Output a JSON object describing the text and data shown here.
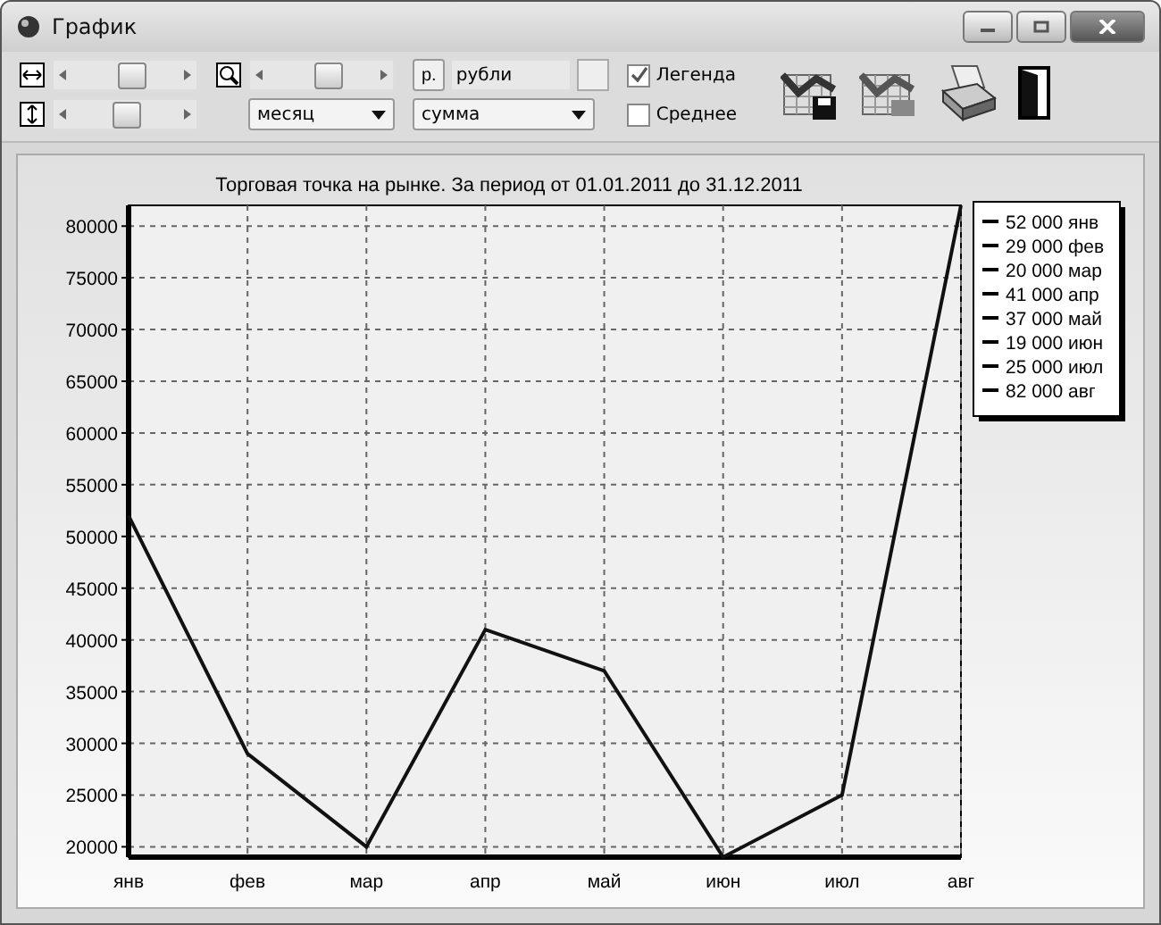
{
  "window": {
    "title": "График"
  },
  "toolbar": {
    "h_scale": {
      "level": 0.55
    },
    "v_scale": {
      "level": 0.5
    },
    "zoom": {
      "level": 0.55
    },
    "period": {
      "value": "месяц"
    },
    "currency_button": "р.",
    "currency": {
      "value": "рубли"
    },
    "measure": {
      "value": "сумма"
    },
    "checkboxes": [
      {
        "label": "Легенда",
        "checked": true
      },
      {
        "label": "Среднее",
        "checked": false
      }
    ]
  },
  "chart": {
    "legend": [
      "52 000 янв",
      "29 000 фев",
      "20 000 мар",
      "41 000 апр",
      "37 000 май",
      "19 000 июн",
      "25 000 июл",
      "82 000 авг"
    ],
    "chart_data": {
      "type": "line",
      "title": "Торговая точка на рынке. За период от 01.01.2011 до 31.12.2011",
      "categories": [
        "янв",
        "фев",
        "мар",
        "апр",
        "май",
        "июн",
        "июл",
        "авг"
      ],
      "series": [
        {
          "color": "#111111",
          "values": [
            52000,
            29000,
            20000,
            41000,
            37000,
            19000,
            25000,
            82000
          ]
        }
      ],
      "grid": true,
      "ylim": [
        19000,
        82000
      ],
      "yticks": [
        20000,
        25000,
        30000,
        35000,
        40000,
        45000,
        50000,
        55000,
        60000,
        65000,
        70000,
        75000,
        80000
      ]
    }
  }
}
